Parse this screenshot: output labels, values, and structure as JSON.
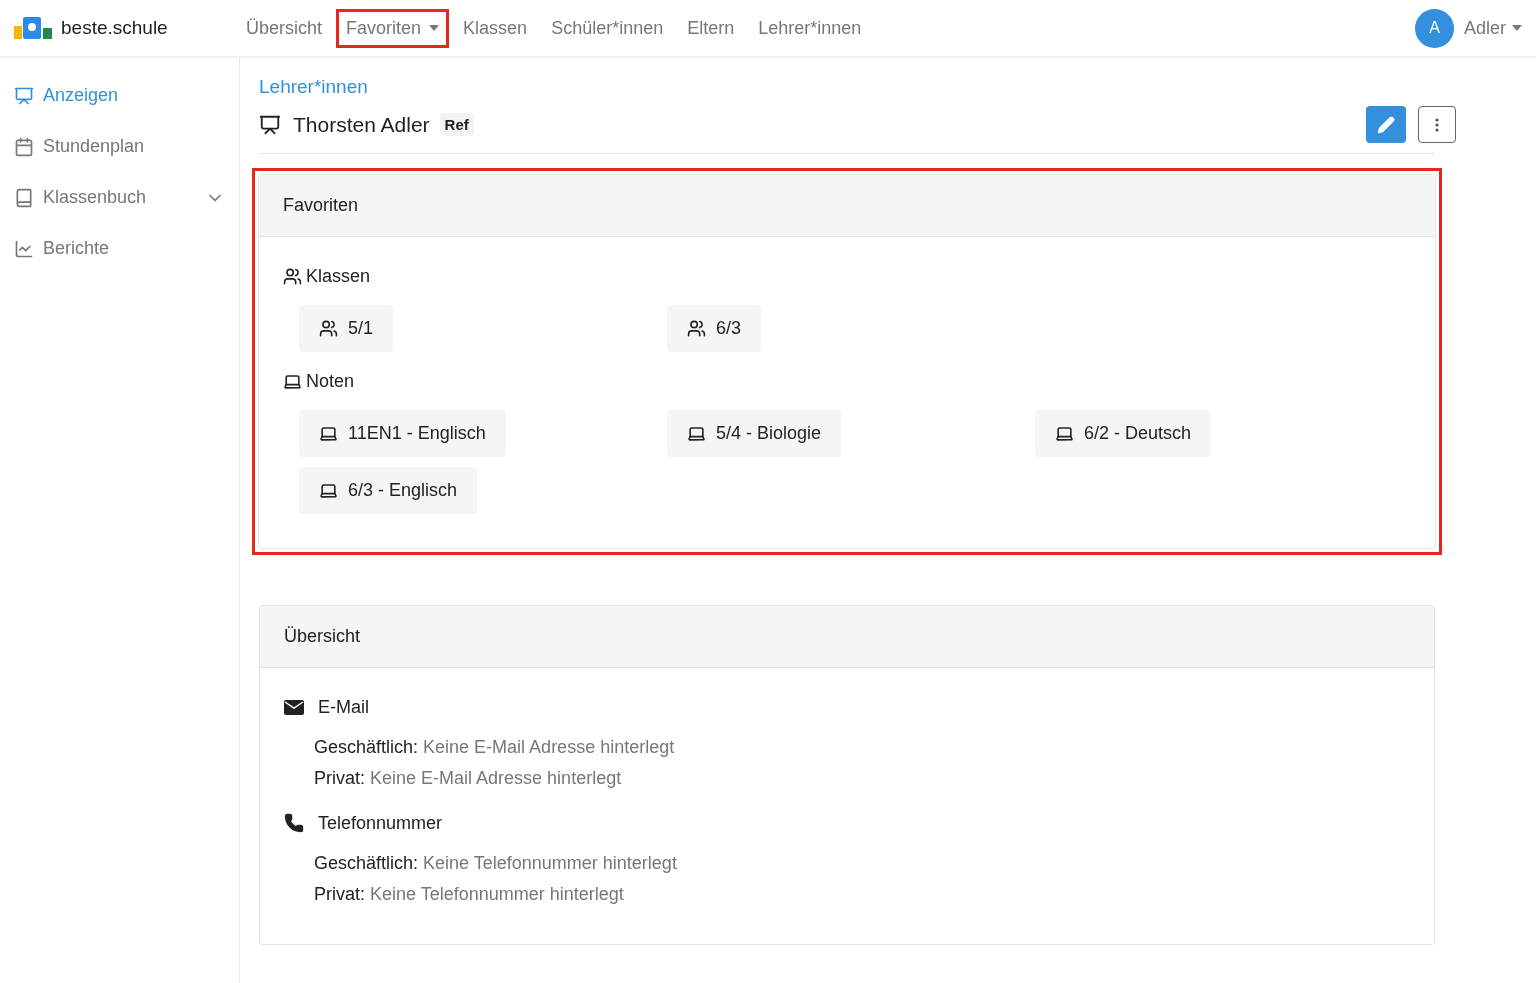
{
  "brand": {
    "name": "beste.schule"
  },
  "nav": [
    {
      "label": "Übersicht",
      "highlighted": false,
      "dropdown": false
    },
    {
      "label": "Favoriten",
      "highlighted": true,
      "dropdown": true
    },
    {
      "label": "Klassen",
      "highlighted": false,
      "dropdown": false
    },
    {
      "label": "Schüler*innen",
      "highlighted": false,
      "dropdown": false
    },
    {
      "label": "Eltern",
      "highlighted": false,
      "dropdown": false
    },
    {
      "label": "Lehrer*innen",
      "highlighted": false,
      "dropdown": false
    }
  ],
  "user": {
    "initial": "A",
    "name": "Adler"
  },
  "sidebar": {
    "items": [
      {
        "label": "Anzeigen",
        "selected": true,
        "kind": "link"
      },
      {
        "label": "Stundenplan",
        "selected": false,
        "kind": "link"
      },
      {
        "label": "Klassenbuch",
        "selected": false,
        "kind": "group"
      },
      {
        "label": "Berichte",
        "selected": false,
        "kind": "link"
      }
    ]
  },
  "breadcrumb": "Lehrer*innen",
  "person": {
    "name": "Thorsten Adler",
    "badge": "Ref"
  },
  "favorites": {
    "title": "Favoriten",
    "highlighted": true,
    "groups": [
      {
        "label": "Klassen",
        "kind": "class",
        "items": [
          "5/1",
          "6/3"
        ]
      },
      {
        "label": "Noten",
        "kind": "grades",
        "items": [
          "11EN1 - Englisch",
          "5/4 - Biologie",
          "6/2 - Deutsch",
          "6/3 - Englisch"
        ]
      }
    ]
  },
  "overview": {
    "title": "Übersicht",
    "sections": [
      {
        "label": "E-Mail",
        "kind": "email",
        "lines": [
          {
            "label": "Geschäftlich:",
            "value": "Keine E-Mail Adresse hinterlegt"
          },
          {
            "label": "Privat:",
            "value": "Keine E-Mail Adresse hinterlegt"
          }
        ]
      },
      {
        "label": "Telefonnummer",
        "kind": "phone",
        "lines": [
          {
            "label": "Geschäftlich:",
            "value": "Keine Telefonnummer hinterlegt"
          },
          {
            "label": "Privat:",
            "value": "Keine Telefonnummer hinterlegt"
          }
        ]
      }
    ]
  }
}
